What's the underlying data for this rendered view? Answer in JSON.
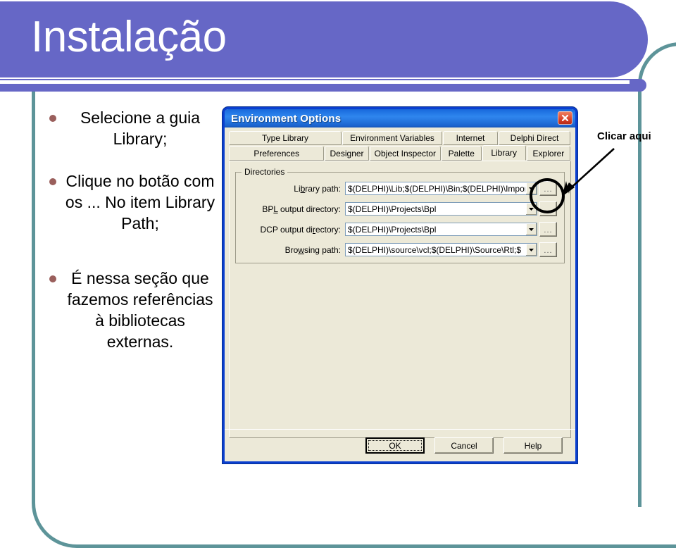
{
  "slide": {
    "title": "Instalação",
    "header_color": "#6667c6",
    "frame_color": "#5d9499",
    "bullet_color": "#9a5f5c",
    "bullets": [
      "Selecione a guia Library;",
      "Clique no botão com os ... No item Library Path;",
      "É nessa seção que fazemos referências à bibliotecas externas."
    ]
  },
  "annotations": {
    "callout_label": "Clicar aqui",
    "circle_target": "library-path-browse-button",
    "arrow_icon": "arrow-down-left-icon"
  },
  "dialog": {
    "title": "Environment Options",
    "close_icon": "close-icon",
    "accent_color": "#1963d4",
    "face_color": "#ece9d8",
    "tabs_row1": [
      {
        "label": "Type Library",
        "selected": false
      },
      {
        "label": "Environment Variables",
        "selected": false
      },
      {
        "label": "Internet",
        "selected": false
      },
      {
        "label": "Delphi Direct",
        "selected": false
      }
    ],
    "tabs_row2": [
      {
        "label": "Preferences",
        "selected": false
      },
      {
        "label": "Designer",
        "selected": false
      },
      {
        "label": "Object Inspector",
        "selected": false
      },
      {
        "label": "Palette",
        "selected": false
      },
      {
        "label": "Library",
        "selected": true
      },
      {
        "label": "Explorer",
        "selected": false
      }
    ],
    "groupbox": {
      "label": "Directories",
      "fields": [
        {
          "label_pre": "Li",
          "label_mn": "b",
          "label_post": "rary path:",
          "value": "$(DELPHI)\\Lib;$(DELPHI)\\Bin;$(DELPHI)\\Impor",
          "dropdown_icon": "chevron-down-icon",
          "browse_label": "..."
        },
        {
          "label_pre": "BP",
          "label_mn": "L",
          "label_post": " output directory:",
          "value": "$(DELPHI)\\Projects\\Bpl",
          "dropdown_icon": "chevron-down-icon",
          "browse_label": "..."
        },
        {
          "label_pre": "DCP output di",
          "label_mn": "r",
          "label_post": "ectory:",
          "value": "$(DELPHI)\\Projects\\Bpl",
          "dropdown_icon": "chevron-down-icon",
          "browse_label": "..."
        },
        {
          "label_pre": "Bro",
          "label_mn": "w",
          "label_post": "sing path:",
          "value": "$(DELPHI)\\source\\vcl;$(DELPHI)\\Source\\Rtl;$",
          "dropdown_icon": "chevron-down-icon",
          "browse_label": "..."
        }
      ]
    },
    "buttons": [
      {
        "label": "OK",
        "default": true
      },
      {
        "label": "Cancel",
        "default": false
      },
      {
        "label": "Help",
        "default": false
      }
    ]
  }
}
